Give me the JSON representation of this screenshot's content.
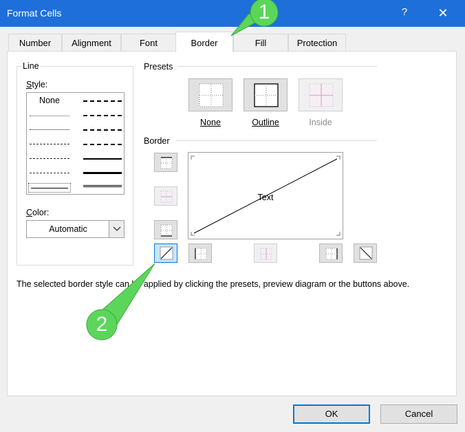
{
  "window": {
    "title": "Format Cells",
    "help": "?",
    "close": "✕"
  },
  "tabs": [
    {
      "label": "Number"
    },
    {
      "label": "Alignment"
    },
    {
      "label": "Font"
    },
    {
      "label": "Border",
      "active": true
    },
    {
      "label": "Fill"
    },
    {
      "label": "Protection"
    }
  ],
  "line": {
    "group_label": "Line",
    "style_label": "Style:",
    "style_none": "None",
    "color_label": "Color:",
    "color_value": "Automatic"
  },
  "presets": {
    "group_label": "Presets",
    "none": "None",
    "outline": "Outline",
    "inside": "Inside"
  },
  "border": {
    "group_label": "Border",
    "preview_text": "Text"
  },
  "hint_text": "The selected border style can be applied by clicking the presets, preview diagram or the buttons above.",
  "buttons": {
    "ok": "OK",
    "cancel": "Cancel"
  },
  "callouts": {
    "one": "1",
    "two": "2",
    "color": "#5bd65b"
  }
}
